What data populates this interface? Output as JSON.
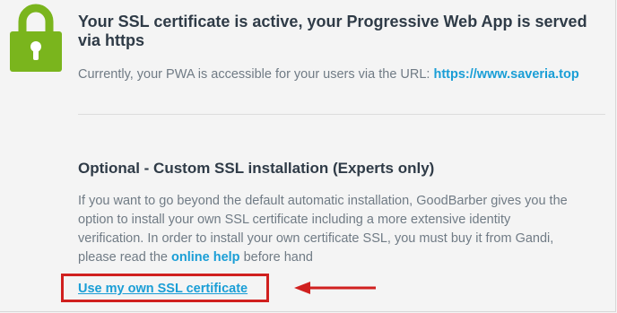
{
  "header": {
    "title": "Your SSL certificate is active, your Progressive Web App is served via https",
    "subtitle_text": "Currently, your PWA is accessible for your users via the URL:",
    "url": "https://www.saveria.top"
  },
  "optional_section": {
    "title": "Optional - Custom SSL installation (Experts only)",
    "line1": "If you want to go beyond the default automatic installation, GoodBarber gives you the",
    "line2": "option to install your own SSL certificate including a more extensive identity",
    "line3": "verification. In order to install your own certificate SSL, you must buy it from Gandi,",
    "line4_before": "please read the",
    "online_help_link": "online help",
    "line4_after": "before hand",
    "action_link": "Use my own SSL certificate"
  },
  "colors": {
    "lock_green": "#7ab51d",
    "link_blue": "#1a9ed6",
    "highlight_red": "#d0201f"
  },
  "icons": {
    "lock": "lock-icon",
    "arrow": "arrow-left-icon"
  }
}
